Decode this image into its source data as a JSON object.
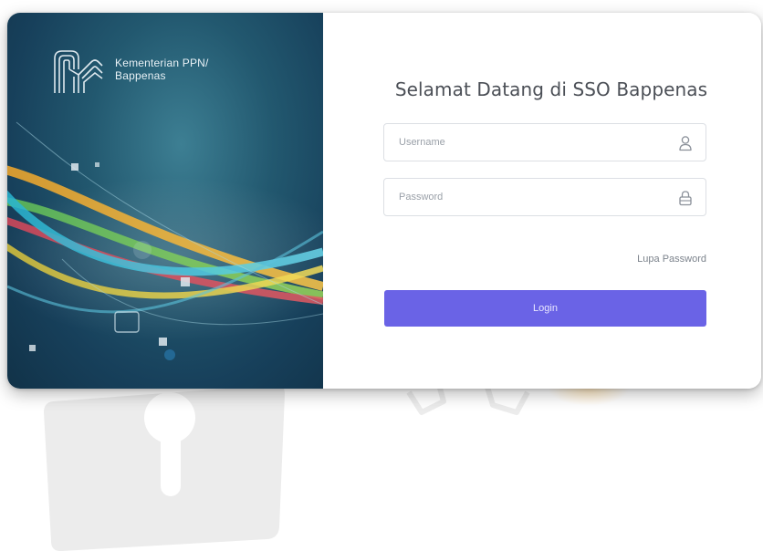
{
  "brand": {
    "line1": "Kementerian PPN/",
    "line2": "Bappenas",
    "logo_icon": "bappenas-logo-icon"
  },
  "login": {
    "title": "Selamat Datang di SSO Bappenas",
    "username": {
      "placeholder": "Username",
      "value": "",
      "icon": "user-icon"
    },
    "password": {
      "placeholder": "Password",
      "value": "",
      "icon": "lock-icon"
    },
    "forgot_label": "Lupa Password",
    "submit_label": "Login"
  },
  "colors": {
    "primary": "#6a63e6",
    "panel_dark": "#17405b",
    "panel_light": "#3d7f93",
    "title_text": "#4b4f56",
    "border": "#dcdfe4"
  },
  "decorations": {
    "background_icons": [
      "padlock-icon",
      "gear-icon"
    ]
  }
}
